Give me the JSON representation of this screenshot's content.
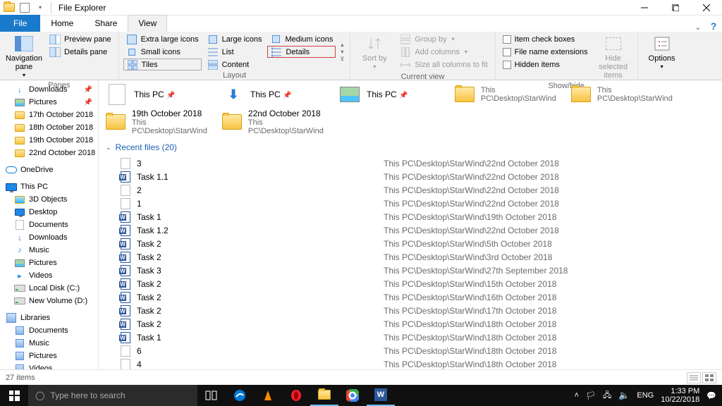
{
  "window": {
    "title": "File Explorer"
  },
  "tabs": {
    "file": "File",
    "home": "Home",
    "share": "Share",
    "view": "View"
  },
  "ribbon": {
    "panes": {
      "nav": "Navigation pane",
      "preview": "Preview pane",
      "details": "Details pane",
      "label": "Panes"
    },
    "layout": {
      "extra_large": "Extra large icons",
      "large": "Large icons",
      "medium": "Medium icons",
      "small": "Small icons",
      "list": "List",
      "details": "Details",
      "tiles": "Tiles",
      "content": "Content",
      "label": "Layout"
    },
    "current": {
      "sort": "Sort by",
      "group": "Group by",
      "add_cols": "Add columns",
      "size_cols": "Size all columns to fit",
      "label": "Current view"
    },
    "showhide": {
      "item_check": "Item check boxes",
      "ext": "File name extensions",
      "hidden": "Hidden items",
      "hide_sel": "Hide selected items",
      "label": "Show/hide"
    },
    "options": "Options"
  },
  "sidebar": {
    "quick": [
      {
        "name": "Downloads",
        "pinned": true,
        "icon": "download"
      },
      {
        "name": "Pictures",
        "pinned": true,
        "icon": "pictures"
      },
      {
        "name": "17th October 2018",
        "icon": "folder"
      },
      {
        "name": "18th October 2018",
        "icon": "folder"
      },
      {
        "name": "19th October 2018",
        "icon": "folder"
      },
      {
        "name": "22nd October 2018",
        "icon": "folder"
      }
    ],
    "onedrive": "OneDrive",
    "thispc": "This PC",
    "pc_items": [
      {
        "name": "3D Objects",
        "icon": "folder3d"
      },
      {
        "name": "Desktop",
        "icon": "desktop"
      },
      {
        "name": "Documents",
        "icon": "documents"
      },
      {
        "name": "Downloads",
        "icon": "download"
      },
      {
        "name": "Music",
        "icon": "music"
      },
      {
        "name": "Pictures",
        "icon": "pictures"
      },
      {
        "name": "Videos",
        "icon": "videos"
      },
      {
        "name": "Local Disk (C:)",
        "icon": "drive"
      },
      {
        "name": "New Volume (D:)",
        "icon": "drive"
      }
    ],
    "libraries": "Libraries",
    "lib_items": [
      {
        "name": "Documents"
      },
      {
        "name": "Music"
      },
      {
        "name": "Pictures"
      },
      {
        "name": "Videos"
      }
    ]
  },
  "frequent": [
    {
      "name": "This PC",
      "path": "",
      "icon": "doc-pin"
    },
    {
      "name": "This PC",
      "path": "",
      "icon": "download-pin"
    },
    {
      "name": "This PC",
      "path": "",
      "icon": "picture-pin"
    },
    {
      "name": "",
      "path": "This PC\\Desktop\\StarWind",
      "icon": "folder"
    },
    {
      "name": "",
      "path": "This PC\\Desktop\\StarWind",
      "icon": "folder"
    },
    {
      "name": "19th October 2018",
      "path": "This PC\\Desktop\\StarWind",
      "icon": "folder"
    },
    {
      "name": "22nd October 2018",
      "path": "This PC\\Desktop\\StarWind",
      "icon": "folder"
    }
  ],
  "recent_header": "Recent files (20)",
  "recent": [
    {
      "name": "3",
      "path": "This PC\\Desktop\\StarWind\\22nd October 2018",
      "icon": "txt"
    },
    {
      "name": "Task 1.1",
      "path": "This PC\\Desktop\\StarWind\\22nd October 2018",
      "icon": "word"
    },
    {
      "name": "2",
      "path": "This PC\\Desktop\\StarWind\\22nd October 2018",
      "icon": "txt"
    },
    {
      "name": "1",
      "path": "This PC\\Desktop\\StarWind\\22nd October 2018",
      "icon": "txt"
    },
    {
      "name": "Task 1",
      "path": "This PC\\Desktop\\StarWind\\19th October 2018",
      "icon": "word"
    },
    {
      "name": "Task 1.2",
      "path": "This PC\\Desktop\\StarWind\\22nd October 2018",
      "icon": "word"
    },
    {
      "name": "Task 2",
      "path": "This PC\\Desktop\\StarWind\\5th October 2018",
      "icon": "word"
    },
    {
      "name": "Task 2",
      "path": "This PC\\Desktop\\StarWind\\3rd October 2018",
      "icon": "word"
    },
    {
      "name": "Task 3",
      "path": "This PC\\Desktop\\StarWind\\27th September 2018",
      "icon": "word"
    },
    {
      "name": "Task 2",
      "path": "This PC\\Desktop\\StarWind\\15th October 2018",
      "icon": "word"
    },
    {
      "name": "Task 2",
      "path": "This PC\\Desktop\\StarWind\\16th October 2018",
      "icon": "word"
    },
    {
      "name": "Task 2",
      "path": "This PC\\Desktop\\StarWind\\17th October 2018",
      "icon": "word"
    },
    {
      "name": "Task 2",
      "path": "This PC\\Desktop\\StarWind\\18th October 2018",
      "icon": "word"
    },
    {
      "name": "Task 1",
      "path": "This PC\\Desktop\\StarWind\\18th October 2018",
      "icon": "word"
    },
    {
      "name": "6",
      "path": "This PC\\Desktop\\StarWind\\18th October 2018",
      "icon": "txt"
    },
    {
      "name": "4",
      "path": "This PC\\Desktop\\StarWind\\18th October 2018",
      "icon": "txt"
    }
  ],
  "status": {
    "items": "27 items"
  },
  "taskbar": {
    "search_placeholder": "Type here to search",
    "lang": "ENG",
    "net": "⚠",
    "vol": "🔈",
    "time": "1:33 PM",
    "date": "10/22/2018"
  }
}
